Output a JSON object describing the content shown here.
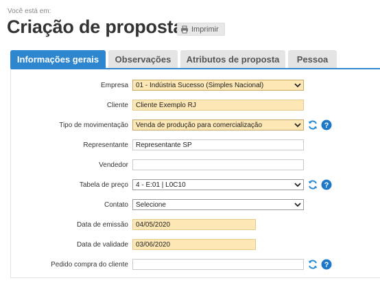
{
  "breadcrumb": "Você está em:",
  "page_title": "Criação de proposta",
  "print_label": "Imprimir",
  "tabs": [
    {
      "label": "Informações gerais",
      "active": true
    },
    {
      "label": "Observações",
      "active": false
    },
    {
      "label": "Atributos de proposta",
      "active": false
    },
    {
      "label": "Pessoa",
      "active": false
    }
  ],
  "form": {
    "empresa": {
      "label": "Empresa",
      "value": "01 - Indústria Sucesso (Simples Nacional)"
    },
    "cliente": {
      "label": "Cliente",
      "value": "Cliente Exemplo RJ"
    },
    "tipo_movimentacao": {
      "label": "Tipo de movimentação",
      "value": "Venda de produção para comercialização"
    },
    "representante": {
      "label": "Representante",
      "value": "Representante SP"
    },
    "vendedor": {
      "label": "Vendedor",
      "value": ""
    },
    "tabela_preco": {
      "label": "Tabela de preço",
      "value": "4 - E:01 | L0C10"
    },
    "contato": {
      "label": "Contato",
      "value": "Selecione"
    },
    "data_emissao": {
      "label": "Data de emissão",
      "value": "04/05/2020"
    },
    "data_validade": {
      "label": "Data de validade",
      "value": "03/06/2020"
    },
    "pedido_compra": {
      "label": "Pedido compra do cliente",
      "value": ""
    }
  },
  "colors": {
    "accent": "#2e86cf",
    "required_field": "#fde7b4",
    "help_icon": "#1e78c8",
    "refresh_icon": "#2a8ad2"
  },
  "icons": {
    "print": "printer-icon",
    "dropdown": "chevron-down-icon",
    "refresh": "refresh-icon",
    "help": "help-icon"
  }
}
